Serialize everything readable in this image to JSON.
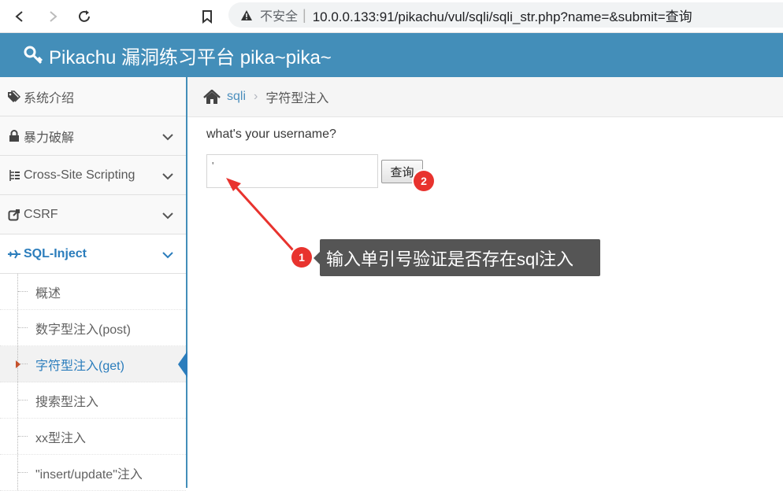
{
  "browser": {
    "security_label": "不安全",
    "url": "10.0.0.133:91/pikachu/vul/sqli/sqli_str.php?name=&submit=查询"
  },
  "header": {
    "title": "Pikachu 漏洞练习平台 pika~pika~"
  },
  "sidebar": {
    "items": [
      {
        "label": "系统介绍",
        "icon": "tags-icon"
      },
      {
        "label": "暴力破解",
        "icon": "lock-icon"
      },
      {
        "label": "Cross-Site Scripting",
        "icon": "list-icon"
      },
      {
        "label": "CSRF",
        "icon": "share-icon"
      },
      {
        "label": "SQL-Inject",
        "icon": "plane-icon"
      }
    ],
    "sub_items": [
      {
        "label": "概述"
      },
      {
        "label": "数字型注入(post)"
      },
      {
        "label": "字符型注入(get)"
      },
      {
        "label": "搜索型注入"
      },
      {
        "label": "xx型注入"
      },
      {
        "label": "\"insert/update\"注入"
      }
    ]
  },
  "breadcrumb": {
    "link": "sqli",
    "current": "字符型注入"
  },
  "form": {
    "question": "what's your username?",
    "input_value": "'",
    "submit_label": "查询"
  },
  "annotations": {
    "badge1": "1",
    "badge2": "2",
    "callout": "输入单引号验证是否存在sql注入"
  },
  "colors": {
    "header": "#438eb9",
    "link": "#2b7dbc",
    "badge": "#e8332e",
    "callout": "#555555"
  }
}
